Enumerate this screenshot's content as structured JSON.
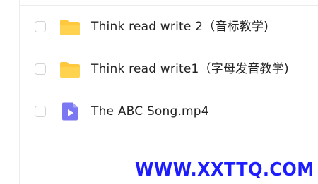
{
  "files": [
    {
      "name": "Think read write 2（音标教学)",
      "type": "folder",
      "icon": "folder-icon",
      "checked": false
    },
    {
      "name": "Think read write1（字母发音教学)",
      "type": "folder",
      "icon": "folder-icon",
      "checked": false
    },
    {
      "name": "The ABC Song.mp4",
      "type": "video",
      "icon": "video-file-icon",
      "checked": false
    }
  ],
  "watermark": "WWW.XXTTQ.COM",
  "colors": {
    "folder": "#ffc83d",
    "video": "#7b76f2",
    "watermark": "#1c1cff"
  }
}
